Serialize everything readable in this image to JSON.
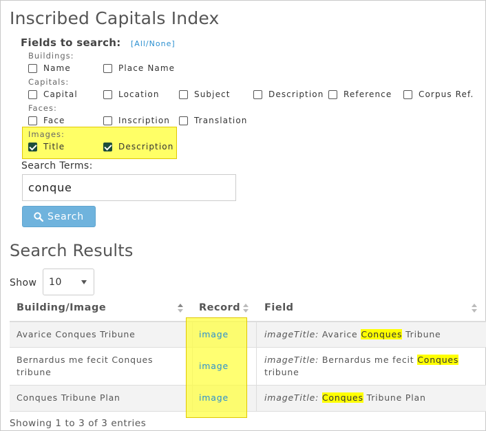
{
  "page": {
    "title": "Inscribed Capitals Index"
  },
  "search_form": {
    "fields_label": "Fields to search:",
    "all_none": "[All/None]",
    "groups": {
      "buildings": {
        "label": "Buildings:",
        "options": [
          {
            "label": "Name",
            "checked": false
          },
          {
            "label": "Place Name",
            "checked": false
          }
        ]
      },
      "capitals": {
        "label": "Capitals:",
        "options": [
          {
            "label": "Capital",
            "checked": false
          },
          {
            "label": "Location",
            "checked": false
          },
          {
            "label": "Subject",
            "checked": false
          },
          {
            "label": "Description",
            "checked": false
          },
          {
            "label": "Reference",
            "checked": false
          },
          {
            "label": "Corpus Ref.",
            "checked": false
          }
        ]
      },
      "faces": {
        "label": "Faces:",
        "options": [
          {
            "label": "Face",
            "checked": false
          },
          {
            "label": "Inscription",
            "checked": false
          },
          {
            "label": "Translation",
            "checked": false
          }
        ]
      },
      "images": {
        "label": "Images:",
        "options": [
          {
            "label": "Title",
            "checked": true
          },
          {
            "label": "Description",
            "checked": true
          }
        ]
      }
    },
    "terms_label": "Search Terms:",
    "terms_value": "conque",
    "search_button": "Search"
  },
  "results": {
    "title": "Search Results",
    "show_label": "Show",
    "page_size": "10",
    "columns": [
      "Building/Image",
      "Record",
      "Field"
    ],
    "rows": [
      {
        "building": "Avarice Conques Tribune",
        "record": "image",
        "field_name": "imageTitle:",
        "field_before": " Avarice ",
        "field_match": "Conques",
        "field_after": " Tribune"
      },
      {
        "building": "Bernardus me fecit Conques tribune",
        "record": "image",
        "field_name": "imageTitle:",
        "field_before": " Bernardus me fecit ",
        "field_match": "Conques",
        "field_after": " tribune"
      },
      {
        "building": "Conques Tribune Plan",
        "record": "image",
        "field_name": "imageTitle:",
        "field_before": " ",
        "field_match": "Conques",
        "field_after": " Tribune Plan"
      }
    ],
    "footer": "Showing 1 to 3 of 3 entries"
  },
  "colors": {
    "highlight": "#ffff66",
    "link": "#2a8fd0",
    "button": "#6fb3dd",
    "checkbox_checked": "#1d4d3a"
  }
}
